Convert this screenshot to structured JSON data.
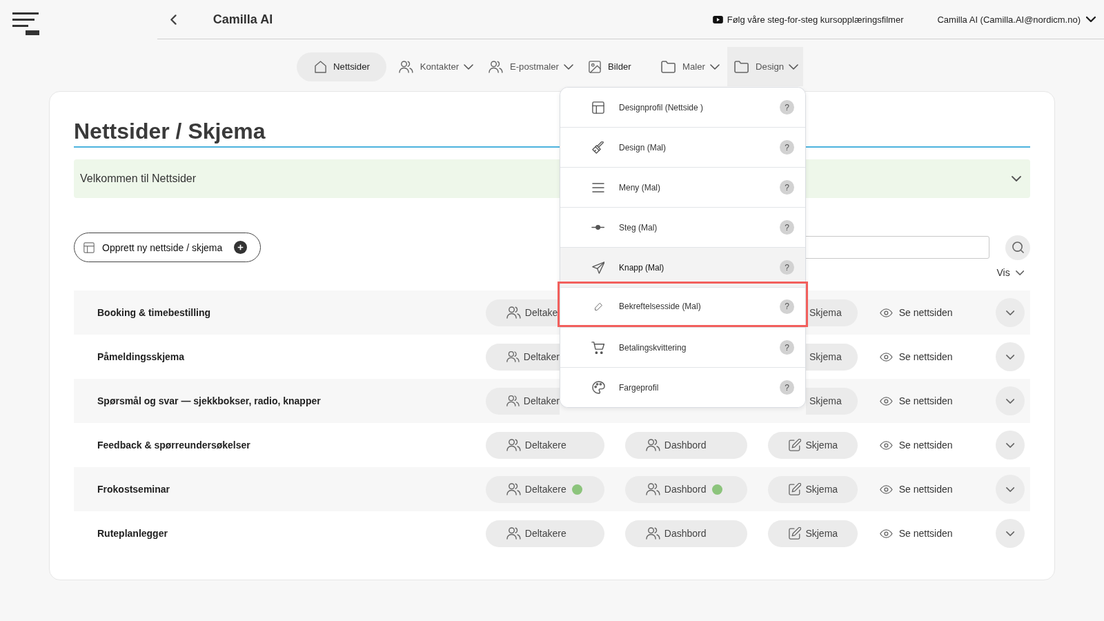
{
  "header": {
    "title": "Camilla AI",
    "tutorial_link": "Følg våre steg-for-steg kursopplæringsfilmer",
    "user": "Camilla AI (Camilla.AI@nordicm.no)"
  },
  "nav": [
    {
      "label": "Nettsider",
      "selected": true,
      "dropdown": false,
      "open": false
    },
    {
      "label": "Kontakter",
      "selected": false,
      "dropdown": true,
      "open": false
    },
    {
      "label": "E-postmaler",
      "selected": false,
      "dropdown": true,
      "open": false
    },
    {
      "label": "Bilder",
      "selected": false,
      "dropdown": false,
      "open": false
    },
    {
      "label": "Maler",
      "selected": false,
      "dropdown": true,
      "open": false
    },
    {
      "label": "Design",
      "selected": false,
      "dropdown": true,
      "open": true
    }
  ],
  "design_menu": [
    {
      "label": "Designprofil (Nettside )",
      "help": "?",
      "hovered": false,
      "highlighted": false
    },
    {
      "label": "Design (Mal)",
      "help": "?",
      "hovered": false,
      "highlighted": false
    },
    {
      "label": "Meny (Mal)",
      "help": "?",
      "hovered": false,
      "highlighted": false
    },
    {
      "label": "Steg (Mal)",
      "help": "?",
      "hovered": false,
      "highlighted": false
    },
    {
      "label": "Knapp (Mal)",
      "help": "?",
      "hovered": true,
      "highlighted": false
    },
    {
      "label": "Bekreftelsesside (Mal)",
      "help": "?",
      "hovered": false,
      "highlighted": true
    },
    {
      "label": "Betalingskvittering",
      "help": "?",
      "hovered": false,
      "highlighted": false
    },
    {
      "label": "Fargeprofil",
      "help": "?",
      "hovered": false,
      "highlighted": false
    }
  ],
  "page": {
    "title": "Nettsider / Skjema",
    "welcome": "Velkommen til Nettsider",
    "create_button": "Opprett ny nettside / skjema",
    "view_toggle": "Vis"
  },
  "rows": [
    {
      "title": "Booking & timebestilling",
      "under_menu": true,
      "participants": {
        "label": "Deltake",
        "status_dot": false
      },
      "form": {
        "label": "Skjema"
      },
      "view": {
        "label": "Se nettsiden"
      }
    },
    {
      "title": "Påmeldingsskjema",
      "under_menu": true,
      "participants": {
        "label": "Deltaker",
        "status_dot": false
      },
      "form": {
        "label": "Skjema"
      },
      "view": {
        "label": "Se nettsiden"
      }
    },
    {
      "title": "Spørsmål og svar — sjekkbokser, radio, knapper",
      "under_menu": true,
      "participants": {
        "label": "Deltaker",
        "status_dot": false
      },
      "form": {
        "label": "Skjema"
      },
      "view": {
        "label": "Se nettsiden"
      }
    },
    {
      "title": "Feedback & spørreundersøkelser",
      "under_menu": false,
      "participants": {
        "label": "Deltakere",
        "status_dot": false
      },
      "dashboard": {
        "label": "Dashbord",
        "status_dot": false
      },
      "form": {
        "label": "Skjema"
      },
      "view": {
        "label": "Se nettsiden"
      }
    },
    {
      "title": "Frokostseminar",
      "under_menu": false,
      "participants": {
        "label": "Deltakere",
        "status_dot": true
      },
      "dashboard": {
        "label": "Dashbord",
        "status_dot": true
      },
      "form": {
        "label": "Skjema"
      },
      "view": {
        "label": "Se nettsiden"
      }
    },
    {
      "title": "Ruteplanlegger",
      "under_menu": false,
      "participants": {
        "label": "Deltakere",
        "status_dot": false
      },
      "dashboard": {
        "label": "Dashbord",
        "status_dot": false
      },
      "form": {
        "label": "Skjema"
      },
      "view": {
        "label": "Se nettsiden"
      }
    }
  ]
}
